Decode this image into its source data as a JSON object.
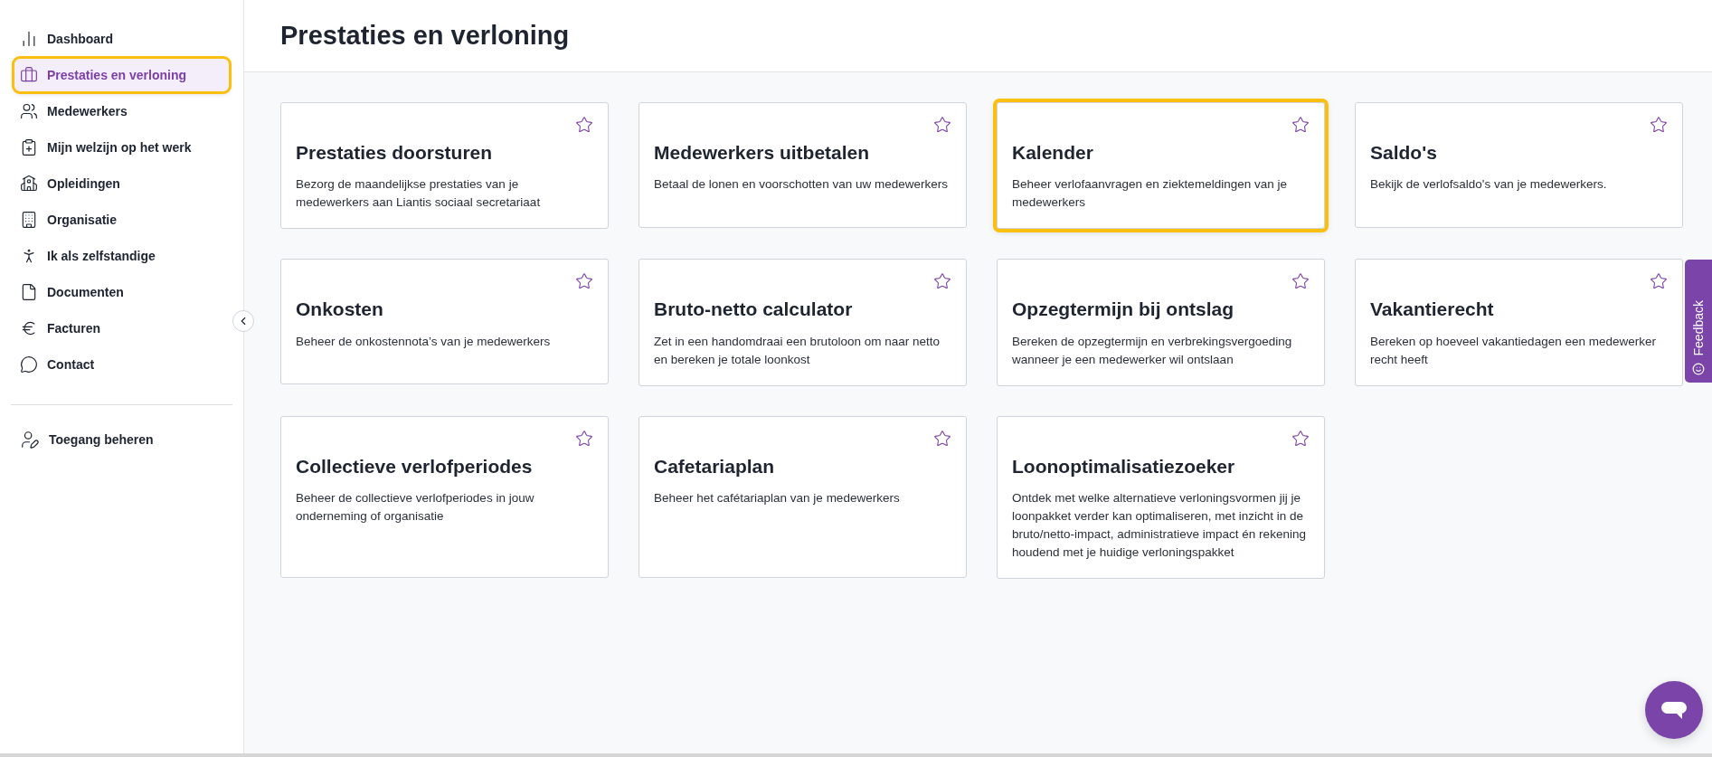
{
  "sidebar": {
    "items": [
      {
        "label": "Dashboard",
        "selected": false,
        "focused": false
      },
      {
        "label": "Prestaties en verloning",
        "selected": true,
        "focused": true
      },
      {
        "label": "Medewerkers",
        "selected": false,
        "focused": false
      },
      {
        "label": "Mijn welzijn op het werk",
        "selected": false,
        "focused": false
      },
      {
        "label": "Opleidingen",
        "selected": false,
        "focused": false
      },
      {
        "label": "Organisatie",
        "selected": false,
        "focused": false
      },
      {
        "label": "Ik als zelfstandige",
        "selected": false,
        "focused": false
      },
      {
        "label": "Documenten",
        "selected": false,
        "focused": false
      },
      {
        "label": "Facturen",
        "selected": false,
        "focused": false
      },
      {
        "label": "Contact",
        "selected": false,
        "focused": false
      }
    ],
    "footer_items": [
      {
        "label": "Toegang beheren",
        "selected": false
      }
    ]
  },
  "page": {
    "title": "Prestaties en verloning"
  },
  "cards": [
    {
      "title": "Prestaties doorsturen",
      "description": "Bezorg de maandelijkse prestaties van je medewerkers aan Liantis sociaal secretariaat",
      "favorite": false,
      "focused": false
    },
    {
      "title": "Medewerkers uitbetalen",
      "description": "Betaal de lonen en voorschotten van uw medewerkers",
      "favorite": false,
      "focused": false
    },
    {
      "title": "Kalender",
      "description": "Beheer verlofaanvragen en ziektemeldingen van je medewerkers",
      "favorite": false,
      "focused": true
    },
    {
      "title": "Saldo's",
      "description": "Bekijk de verlofsaldo's van je medewerkers.",
      "favorite": false,
      "focused": false
    },
    {
      "title": "Onkosten",
      "description": "Beheer de onkostennota’s van je medewerkers",
      "favorite": false,
      "focused": false
    },
    {
      "title": "Bruto-netto calculator",
      "description": "Zet in een handomdraai een brutoloon om naar netto en bereken je totale loonkost",
      "favorite": false,
      "focused": false
    },
    {
      "title": "Opzegtermijn bij ontslag",
      "description": "Bereken de opzegtermijn en verbrekingsvergoeding wanneer je een medewerker wil ontslaan",
      "favorite": false,
      "focused": false
    },
    {
      "title": "Vakantierecht",
      "description": "Bereken op hoeveel vakantiedagen een medewerker recht heeft",
      "favorite": false,
      "focused": false
    },
    {
      "title": "Collectieve verlofperiodes",
      "description": "Beheer de collectieve verlofperiodes in jouw onderneming of organisatie",
      "favorite": false,
      "focused": false
    },
    {
      "title": "Cafetariaplan",
      "description": "Beheer het cafétariaplan van je medewerkers",
      "favorite": false,
      "focused": false
    },
    {
      "title": "Loonoptimalisatiezoeker",
      "description": "Ontdek met welke alternatieve verloningsvormen jij je loonpakket verder kan optimaliseren, met inzicht in de bruto/netto-impact, administratieve impact én rekening houdend met je huidige verloningspakket",
      "favorite": false,
      "focused": false
    }
  ],
  "feedback_tab": {
    "label": "Feedback"
  }
}
